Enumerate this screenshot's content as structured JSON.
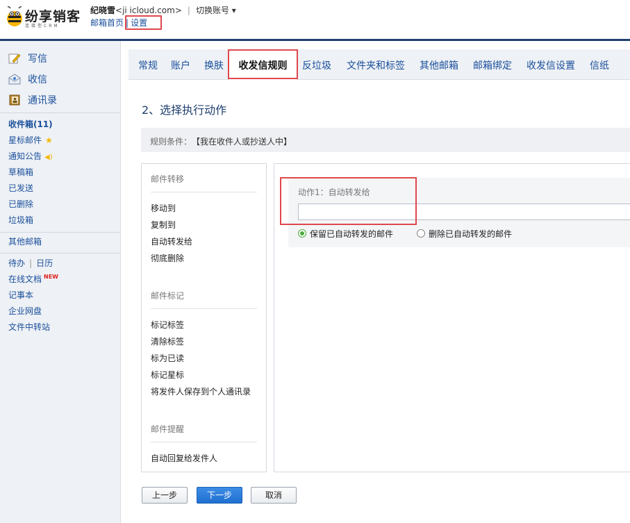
{
  "header": {
    "logo_text": "纷享销客",
    "logo_sub": "连接型CRM",
    "user_name": "纪晓雪",
    "user_email": "<ji                   icloud.com>",
    "separator": "|",
    "switch_account": "切换账号 ▾",
    "nav_home": "邮箱首页",
    "nav_settings": "设置"
  },
  "sidebar": {
    "main_items": [
      {
        "label": "写信",
        "icon": "compose-icon"
      },
      {
        "label": "收信",
        "icon": "inbox-receive-icon"
      },
      {
        "label": "通讯录",
        "icon": "contacts-icon"
      }
    ],
    "folders": [
      {
        "label": "收件箱(11)"
      },
      {
        "label": "星标邮件"
      },
      {
        "label": "通知公告"
      },
      {
        "label": "草稿箱"
      },
      {
        "label": "已发送"
      },
      {
        "label": "已删除"
      },
      {
        "label": "垃圾箱"
      }
    ],
    "other_mailbox": "其他邮箱",
    "tools": {
      "todo": "待办",
      "calendar": "日历",
      "online_docs": "在线文档",
      "new_badge": "NEW",
      "notes": "记事本",
      "netdisk": "企业网盘",
      "file_transfer": "文件中转站"
    }
  },
  "tabs": [
    {
      "label": "常规"
    },
    {
      "label": "账户"
    },
    {
      "label": "换肤"
    },
    {
      "label": "收发信规则"
    },
    {
      "label": "反垃圾"
    },
    {
      "label": "文件夹和标签"
    },
    {
      "label": "其他邮箱"
    },
    {
      "label": "邮箱绑定"
    },
    {
      "label": "收发信设置"
    },
    {
      "label": "信纸"
    }
  ],
  "active_tab": "收发信规则",
  "step_title": "2、选择执行动作",
  "condition": {
    "label": "规则条件：",
    "value": "【我在收件人或抄送人中】"
  },
  "action_groups": [
    {
      "title": "邮件转移",
      "items": [
        "移动到",
        "复制到",
        "自动转发给",
        "彻底删除"
      ]
    },
    {
      "title": "邮件标记",
      "items": [
        "标记标签",
        "清除标签",
        "标为已读",
        "标记星标",
        "将发件人保存到个人通讯录"
      ]
    },
    {
      "title": "邮件提醒",
      "items": [
        "自动回复给发件人"
      ]
    }
  ],
  "detail": {
    "action_label": "动作1：自动转发给",
    "input_value": "",
    "radio_keep": "保留已自动转发的邮件",
    "radio_delete": "删除已自动转发的邮件",
    "selected": "keep"
  },
  "buttons": {
    "prev": "上一步",
    "next": "下一步",
    "cancel": "取消"
  },
  "colors": {
    "link_blue": "#1a4f9c",
    "header_bar": "#1f3f6e",
    "highlight_red": "#e0474c",
    "radio_green": "#4caa3c",
    "primary_button": "#1f6fd0"
  }
}
